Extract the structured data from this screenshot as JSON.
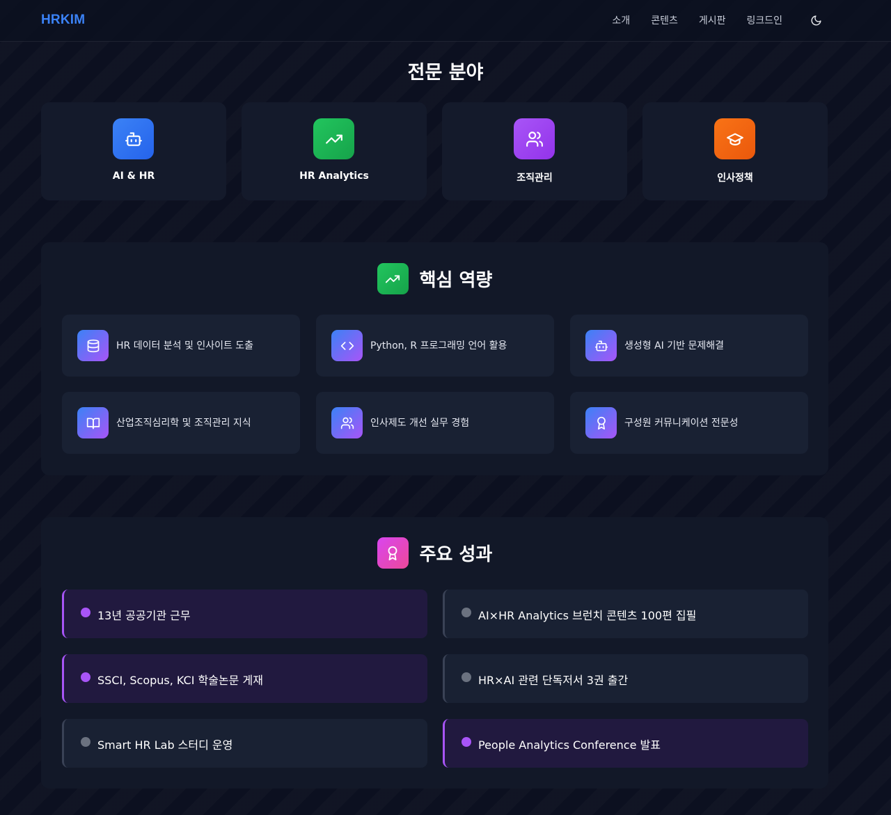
{
  "nav": {
    "brand": "HRKIM",
    "links": [
      "소개",
      "콘텐츠",
      "게시판",
      "링크드인"
    ],
    "theme_icon": "moon-icon"
  },
  "expertise": {
    "title": "전문 분야",
    "cards": [
      {
        "label": "AI & HR",
        "icon": "robot-icon",
        "color": "#3b82f6"
      },
      {
        "label": "HR Analytics",
        "icon": "trending-up-icon",
        "color": "#22c55e"
      },
      {
        "label": "조직관리",
        "icon": "users-icon",
        "color": "#a855f7"
      },
      {
        "label": "인사정책",
        "icon": "graduation-cap-icon",
        "color": "#f97316"
      }
    ]
  },
  "skills": {
    "title": "핵심 역량",
    "icon": "trending-up-icon",
    "items": [
      {
        "label": "HR 데이터 분석 및 인사이트 도출",
        "icon": "database-icon"
      },
      {
        "label": "Python, R 프로그래밍 언어 활용",
        "icon": "code-icon"
      },
      {
        "label": "생성형 AI 기반 문제해결",
        "icon": "robot-icon"
      },
      {
        "label": "산업조직심리학 및 조직관리 지식",
        "icon": "book-icon"
      },
      {
        "label": "인사제도 개선 실무 경험",
        "icon": "users-icon"
      },
      {
        "label": "구성원 커뮤니케이션 전문성",
        "icon": "award-icon"
      }
    ]
  },
  "achievements": {
    "title": "주요 성과",
    "icon": "award-icon",
    "items": [
      {
        "label": "13년 공공기관 근무",
        "highlighted": true
      },
      {
        "label": "AI×HR Analytics 브런치 콘텐츠 100편 집필",
        "highlighted": false
      },
      {
        "label": "SSCI, Scopus, KCI 학술논문 게재",
        "highlighted": true
      },
      {
        "label": "HR×AI 관련 단독저서 3권 출간",
        "highlighted": false
      },
      {
        "label": "Smart HR Lab 스터디 운영",
        "highlighted": false
      },
      {
        "label": "People Analytics Conference 발표",
        "highlighted": true
      }
    ]
  }
}
